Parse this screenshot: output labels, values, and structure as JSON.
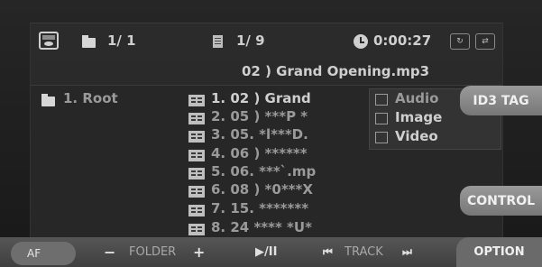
{
  "header": {
    "folder_counter": "1/ 1",
    "file_counter": "1/ 9",
    "elapsed_time": "0:00:27",
    "current_file": "02 ) Grand Opening.mp3"
  },
  "folders": [
    {
      "label": "1. Root"
    }
  ],
  "files": [
    {
      "label": "1. 02 ) Grand"
    },
    {
      "label": "2. 05 ) ***P *"
    },
    {
      "label": "3. 05. *l***D."
    },
    {
      "label": "4. 06 ) ******"
    },
    {
      "label": "5. 06. ***`.mp"
    },
    {
      "label": "6. 08 ) *0***X"
    },
    {
      "label": "7. 15. *******"
    },
    {
      "label": "8. 24 **** *U*"
    }
  ],
  "media_types": [
    {
      "label": "Audio",
      "icon": "speaker-icon"
    },
    {
      "label": "Image",
      "icon": "picture-icon"
    },
    {
      "label": "Video",
      "icon": "film-icon"
    }
  ],
  "side_buttons": {
    "id3_tag": "ID3 TAG",
    "control": "CONTROL"
  },
  "bottom_bar": {
    "af": "AF",
    "folder_minus": "−",
    "folder_label": "FOLDER",
    "folder_plus": "+",
    "play_pause": "▶/II",
    "track_prev": "⏮",
    "track_label": "TRACK",
    "track_next": "⏭",
    "option": "OPTION"
  },
  "colors": {
    "background": "#1d1d1d",
    "panel": "#272727",
    "text": "#cfcfcf",
    "button": "#8a8a8a"
  }
}
